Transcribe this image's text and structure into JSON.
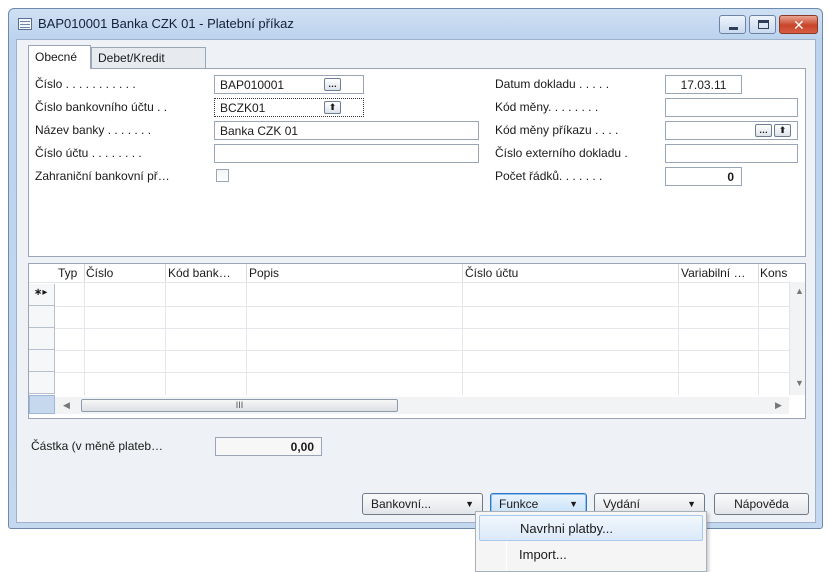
{
  "window": {
    "title": "BAP010001 Banka CZK 01 - Platební příkaz"
  },
  "tabs": [
    "Obecné",
    "Debet/Kredit"
  ],
  "form": {
    "cislo": {
      "label": "Číslo . . . . . . . . . . .",
      "value": "BAP010001"
    },
    "cislo_bank_uctu": {
      "label": "Číslo bankovního účtu . .",
      "value": "BCZK01"
    },
    "nazev_banky": {
      "label": "Název banky . . . . . . .",
      "value": "Banka CZK 01"
    },
    "cislo_uctu": {
      "label": "Číslo účtu . . . . . . . .",
      "value": ""
    },
    "zahranicni": {
      "label": "Zahraniční bankovní př…",
      "checked": false
    },
    "datum_dokladu": {
      "label": "Datum dokladu . . . . .",
      "value": "17.03.11"
    },
    "kod_meny": {
      "label": "Kód měny. . . . . . . .",
      "value": ""
    },
    "kod_meny_prikazu": {
      "label": "Kód měny příkazu . . . .",
      "value": ""
    },
    "cislo_ext_dokladu": {
      "label": "Číslo externího dokladu .",
      "value": ""
    },
    "pocet_radku": {
      "label": "Počet řádků. . . . . . .",
      "value": "0"
    }
  },
  "grid": {
    "columns": [
      "Typ",
      "Číslo",
      "Kód bank…",
      "Popis",
      "Číslo účtu",
      "Variabilní …",
      "Kons"
    ],
    "new_row_marker": "∗▸",
    "scroll_thumb_grip": "III"
  },
  "summary": {
    "label": "Částka (v měně plateb…",
    "value": "0,00"
  },
  "buttons": {
    "bankovni": "Bankovní...",
    "funkce": "Funkce",
    "vydani": "Vydání",
    "napoveda": "Nápověda"
  },
  "menu": {
    "items": [
      "Navrhni platby...",
      "Import..."
    ]
  },
  "icons": {
    "lookup": "…",
    "drilldown": "⬆",
    "dropdown": "▼",
    "close": "✕"
  }
}
